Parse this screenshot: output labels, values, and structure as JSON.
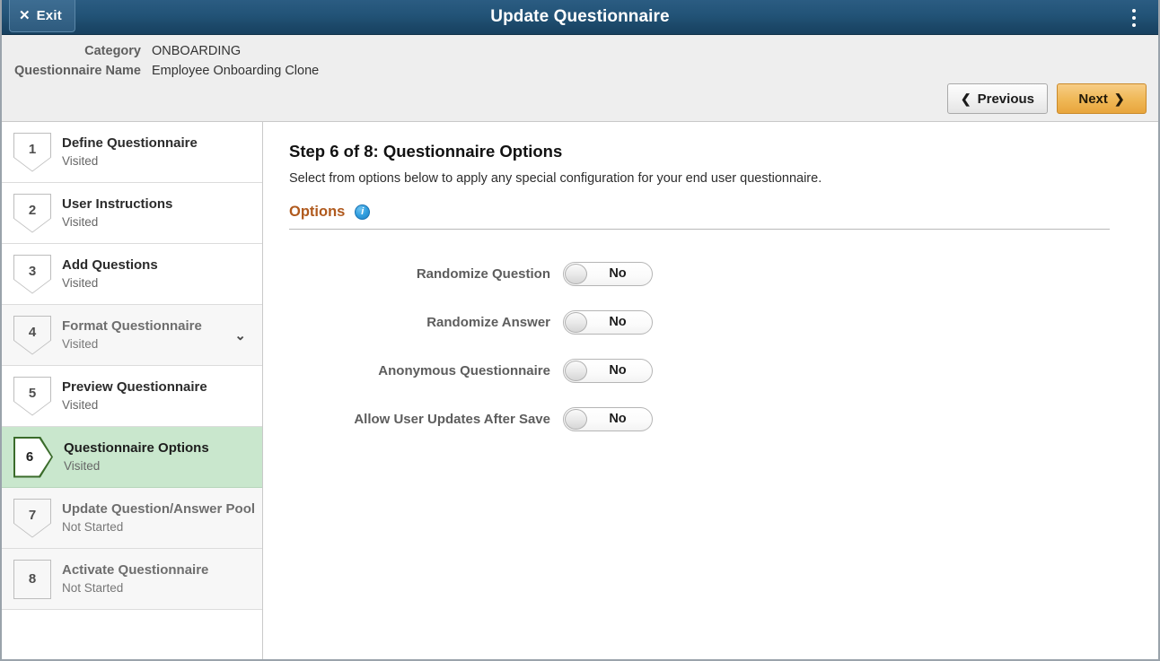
{
  "titlebar": {
    "exit_label": "Exit",
    "exit_icon": "close-x-icon",
    "title": "Update Questionnaire",
    "menu_icon": "kebab-menu-icon"
  },
  "subheader": {
    "fields": [
      {
        "label": "Category",
        "value": "ONBOARDING"
      },
      {
        "label": "Questionnaire Name",
        "value": "Employee Onboarding Clone"
      }
    ],
    "previous_label": "Previous",
    "previous_icon": "chevron-left-icon",
    "next_label": "Next",
    "next_icon": "chevron-right-icon"
  },
  "sidebar": {
    "steps": [
      {
        "num": "1",
        "title": "Define Questionnaire",
        "status": "Visited",
        "state": "normal",
        "chevron": ""
      },
      {
        "num": "2",
        "title": "User Instructions",
        "status": "Visited",
        "state": "normal",
        "chevron": ""
      },
      {
        "num": "3",
        "title": "Add Questions",
        "status": "Visited",
        "state": "normal",
        "chevron": ""
      },
      {
        "num": "4",
        "title": "Format Questionnaire",
        "status": "Visited",
        "state": "dim",
        "chevron": "⌄"
      },
      {
        "num": "5",
        "title": "Preview Questionnaire",
        "status": "Visited",
        "state": "normal",
        "chevron": ""
      },
      {
        "num": "6",
        "title": "Questionnaire Options",
        "status": "Visited",
        "state": "active",
        "chevron": ""
      },
      {
        "num": "7",
        "title": "Update Question/Answer Pool",
        "status": "Not Started",
        "state": "dim",
        "chevron": ""
      },
      {
        "num": "8",
        "title": "Activate Questionnaire",
        "status": "Not Started",
        "state": "dim",
        "chevron": ""
      }
    ]
  },
  "main": {
    "step_title": "Step 6 of 8: Questionnaire Options",
    "description": "Select from options below to apply any special configuration for your end user questionnaire.",
    "section_title": "Options",
    "info_icon": "info-icon",
    "info_glyph": "i",
    "options": [
      {
        "label": "Randomize Question",
        "value": "No"
      },
      {
        "label": "Randomize Answer",
        "value": "No"
      },
      {
        "label": "Anonymous Questionnaire",
        "value": "No"
      },
      {
        "label": "Allow User Updates After Save",
        "value": "No"
      }
    ]
  },
  "colors": {
    "header_blue": "#225377",
    "next_orange": "#efb85a",
    "active_green": "#c9e7cd",
    "active_badge_green": "#3a6b2a",
    "section_orange": "#b05a1e",
    "info_blue": "#1d7fc4"
  }
}
